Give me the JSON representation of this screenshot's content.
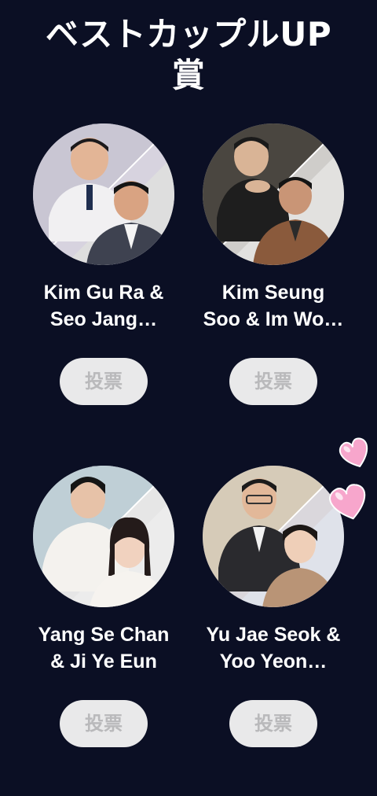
{
  "page": {
    "title": "ベストカップルUP\n賞"
  },
  "couples": [
    {
      "name": "Kim Gu Ra &\nSeo Jang…",
      "vote_label": "投票"
    },
    {
      "name": "Kim Seung\nSoo & Im Wo…",
      "vote_label": "投票"
    },
    {
      "name": "Yang Se Chan\n& Ji Ye Eun",
      "vote_label": "投票"
    },
    {
      "name": "Yu Jae Seok &\nYoo Yeon…",
      "vote_label": "投票"
    }
  ],
  "colors": {
    "background": "#0b0f24",
    "button_bg": "#e9e9ea",
    "button_text": "#b9b9bb",
    "heart": "#f7a6cc"
  },
  "icons": {
    "decoration": "hearts-icon"
  }
}
